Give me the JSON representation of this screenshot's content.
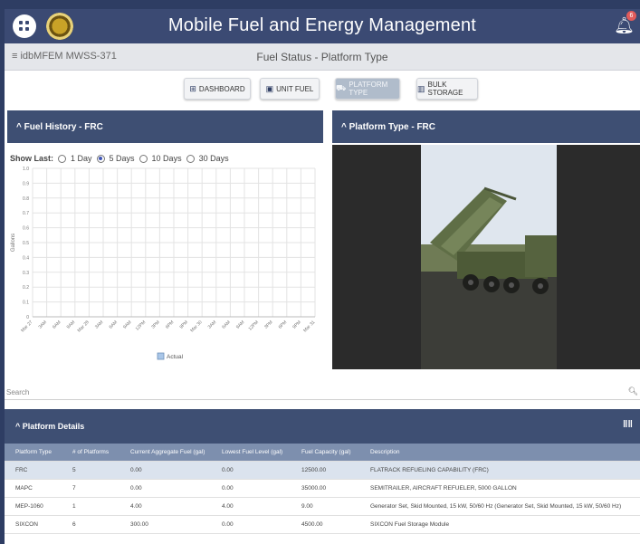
{
  "app": {
    "title": "Mobile Fuel and Energy Management",
    "notification_count": "6"
  },
  "subbar": {
    "crumb": "≡ idbMFEM MWSS-371",
    "page_title": "Fuel Status - Platform Type"
  },
  "tabs": [
    {
      "label": "DASHBOARD",
      "icon": "dashboard-icon"
    },
    {
      "label": "UNIT FUEL",
      "icon": "fuel-pump-icon"
    },
    {
      "label": "PLATFORM TYPE",
      "icon": "truck-icon",
      "active": true
    },
    {
      "label": "BULK STORAGE",
      "icon": "storage-icon"
    }
  ],
  "fuel_history": {
    "panel_title": "^ Fuel History - FRC",
    "show_last_label": "Show Last:",
    "options": [
      "1 Day",
      "5 Days",
      "10 Days",
      "30 Days"
    ],
    "selected_option": "5 Days"
  },
  "platform_panel": {
    "panel_title": "^ Platform Type - FRC"
  },
  "chart_data": {
    "type": "line",
    "title": "",
    "xlabel": "",
    "ylabel": "Gallons",
    "yticks": [
      "0",
      "0.1",
      "0.2",
      "0.3",
      "0.4",
      "0.5",
      "0.6",
      "0.7",
      "0.8",
      "0.9",
      "1.0"
    ],
    "ylim": [
      0,
      1.0
    ],
    "x_tick_labels": [
      "Mar 27",
      "3AM",
      "6AM",
      "9AM",
      "Mar 28",
      "3AM",
      "6AM",
      "9AM",
      "12PM",
      "3PM",
      "6PM",
      "9PM",
      "Mar 30",
      "3AM",
      "6AM",
      "9AM",
      "12PM",
      "3PM",
      "6PM",
      "9PM",
      "Mar 31"
    ],
    "series": [
      {
        "name": "Actual",
        "values": []
      }
    ],
    "grid": true,
    "legend_position": "bottom"
  },
  "search": {
    "placeholder": "Search"
  },
  "details": {
    "panel_title": "^ Platform Details",
    "columns": [
      "Platform Type",
      "# of Platforms",
      "Current Aggregate Fuel (gal)",
      "Lowest Fuel Level (gal)",
      "Fuel Capacity (gal)",
      "Description"
    ],
    "rows": [
      [
        "FRC",
        "5",
        "0.00",
        "0.00",
        "12500.00",
        "FLATRACK REFUELING CAPABILITY (FRC)"
      ],
      [
        "MAPC",
        "7",
        "0.00",
        "0.00",
        "35000.00",
        "SEMITRAILER, AIRCRAFT REFUELER, 5000 GALLON"
      ],
      [
        "MEP-1060",
        "1",
        "4.00",
        "4.00",
        "9.00",
        "Generator Set, Skid Mounted, 15 kW, 50/60 Hz (Generator Set, Skid Mounted, 15 kW, 50/60 Hz)"
      ],
      [
        "SIXCON",
        "6",
        "300.00",
        "0.00",
        "4500.00",
        "SIXCON Fuel Storage Module"
      ]
    ]
  }
}
